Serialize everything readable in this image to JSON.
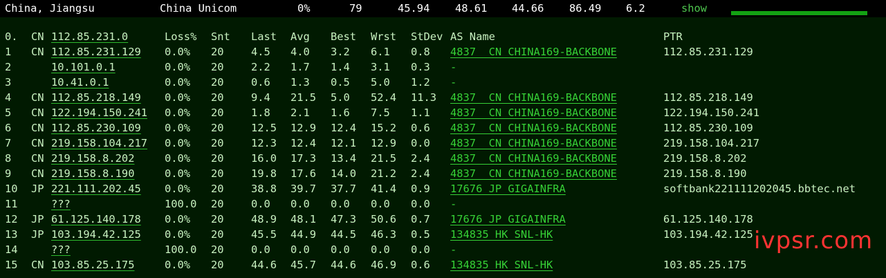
{
  "summary": {
    "location": "China, Jiangsu",
    "isp": "China Unicom",
    "loss": "0%",
    "snt": "79",
    "last": "45.94",
    "avg": "48.61",
    "best": "44.66",
    "wrst": "86.49",
    "stdev": "6.2",
    "action": "show"
  },
  "table": {
    "headers": {
      "hop": "0.",
      "cc": "CN",
      "host": "112.85.231.0",
      "loss": "Loss%",
      "snt": "Snt",
      "last": "Last",
      "avg": "Avg",
      "best": "Best",
      "wrst": "Wrst",
      "stdev": "StDev",
      "as": "AS Name",
      "ptr": "PTR"
    },
    "rows": [
      {
        "hop": "1",
        "cc": "CN",
        "host": "112.85.231.129",
        "loss": "0.0%",
        "snt": "20",
        "last": "4.5",
        "avg": "4.0",
        "best": "3.2",
        "wrst": "6.1",
        "stdev": "0.8",
        "as": "4837  CN CHINA169-BACKBONE",
        "ptr": "112.85.231.129"
      },
      {
        "hop": "2",
        "cc": "",
        "host": "10.101.0.1",
        "loss": "0.0%",
        "snt": "20",
        "last": "2.2",
        "avg": "1.7",
        "best": "1.4",
        "wrst": "3.1",
        "stdev": "0.3",
        "as": "-",
        "ptr": ""
      },
      {
        "hop": "3",
        "cc": "",
        "host": "10.41.0.1",
        "loss": "0.0%",
        "snt": "20",
        "last": "0.6",
        "avg": "1.3",
        "best": "0.5",
        "wrst": "5.0",
        "stdev": "1.2",
        "as": "-",
        "ptr": ""
      },
      {
        "hop": "4",
        "cc": "CN",
        "host": "112.85.218.149",
        "loss": "0.0%",
        "snt": "20",
        "last": "9.4",
        "avg": "21.5",
        "best": "5.0",
        "wrst": "52.4",
        "stdev": "11.3",
        "as": "4837  CN CHINA169-BACKBONE",
        "ptr": "112.85.218.149"
      },
      {
        "hop": "5",
        "cc": "CN",
        "host": "122.194.150.241",
        "loss": "0.0%",
        "snt": "20",
        "last": "1.8",
        "avg": "2.1",
        "best": "1.6",
        "wrst": "7.5",
        "stdev": "1.1",
        "as": "4837  CN CHINA169-BACKBONE",
        "ptr": "122.194.150.241"
      },
      {
        "hop": "6",
        "cc": "CN",
        "host": "112.85.230.109",
        "loss": "0.0%",
        "snt": "20",
        "last": "12.5",
        "avg": "12.9",
        "best": "12.4",
        "wrst": "15.2",
        "stdev": "0.6",
        "as": "4837  CN CHINA169-BACKBONE",
        "ptr": "112.85.230.109"
      },
      {
        "hop": "7",
        "cc": "CN",
        "host": "219.158.104.217",
        "loss": "0.0%",
        "snt": "20",
        "last": "12.3",
        "avg": "12.4",
        "best": "12.1",
        "wrst": "12.9",
        "stdev": "0.0",
        "as": "4837  CN CHINA169-BACKBONE",
        "ptr": "219.158.104.217"
      },
      {
        "hop": "8",
        "cc": "CN",
        "host": "219.158.8.202",
        "loss": "0.0%",
        "snt": "20",
        "last": "16.0",
        "avg": "17.3",
        "best": "13.4",
        "wrst": "21.5",
        "stdev": "2.4",
        "as": "4837  CN CHINA169-BACKBONE",
        "ptr": "219.158.8.202"
      },
      {
        "hop": "9",
        "cc": "CN",
        "host": "219.158.8.190",
        "loss": "0.0%",
        "snt": "20",
        "last": "19.8",
        "avg": "17.6",
        "best": "14.0",
        "wrst": "21.2",
        "stdev": "2.4",
        "as": "4837  CN CHINA169-BACKBONE",
        "ptr": "219.158.8.190"
      },
      {
        "hop": "10",
        "cc": "JP",
        "host": "221.111.202.45",
        "loss": "0.0%",
        "snt": "20",
        "last": "38.8",
        "avg": "39.7",
        "best": "37.7",
        "wrst": "41.4",
        "stdev": "0.9",
        "as": "17676 JP GIGAINFRA",
        "ptr": "softbank221111202045.bbtec.net"
      },
      {
        "hop": "11",
        "cc": "",
        "host": "???",
        "loss": "100.0",
        "snt": "20",
        "last": "0.0",
        "avg": "0.0",
        "best": "0.0",
        "wrst": "0.0",
        "stdev": "0.0",
        "as": "-",
        "ptr": ""
      },
      {
        "hop": "12",
        "cc": "JP",
        "host": "61.125.140.178",
        "loss": "0.0%",
        "snt": "20",
        "last": "48.9",
        "avg": "48.1",
        "best": "47.3",
        "wrst": "50.6",
        "stdev": "0.7",
        "as": "17676 JP GIGAINFRA",
        "ptr": "61.125.140.178"
      },
      {
        "hop": "13",
        "cc": "JP",
        "host": "103.194.42.125",
        "loss": "0.0%",
        "snt": "20",
        "last": "45.5",
        "avg": "44.9",
        "best": "44.5",
        "wrst": "46.3",
        "stdev": "0.5",
        "as": "134835 HK SNL-HK",
        "ptr": "103.194.42.125"
      },
      {
        "hop": "14",
        "cc": "",
        "host": "???",
        "loss": "100.0",
        "snt": "20",
        "last": "0.0",
        "avg": "0.0",
        "best": "0.0",
        "wrst": "0.0",
        "stdev": "0.0",
        "as": "-",
        "ptr": ""
      },
      {
        "hop": "15",
        "cc": "CN",
        "host": "103.85.25.175",
        "loss": "0.0%",
        "snt": "20",
        "last": "44.6",
        "avg": "45.7",
        "best": "44.6",
        "wrst": "46.9",
        "stdev": "0.6",
        "as": "134835 HK SNL-HK",
        "ptr": "103.85.25.175"
      }
    ]
  },
  "watermark": "ivpsr.com",
  "colors": {
    "terminal_bg": "#011a01",
    "text": "#c8f0c0",
    "link": "#36d036",
    "watermark": "#ff3333"
  }
}
